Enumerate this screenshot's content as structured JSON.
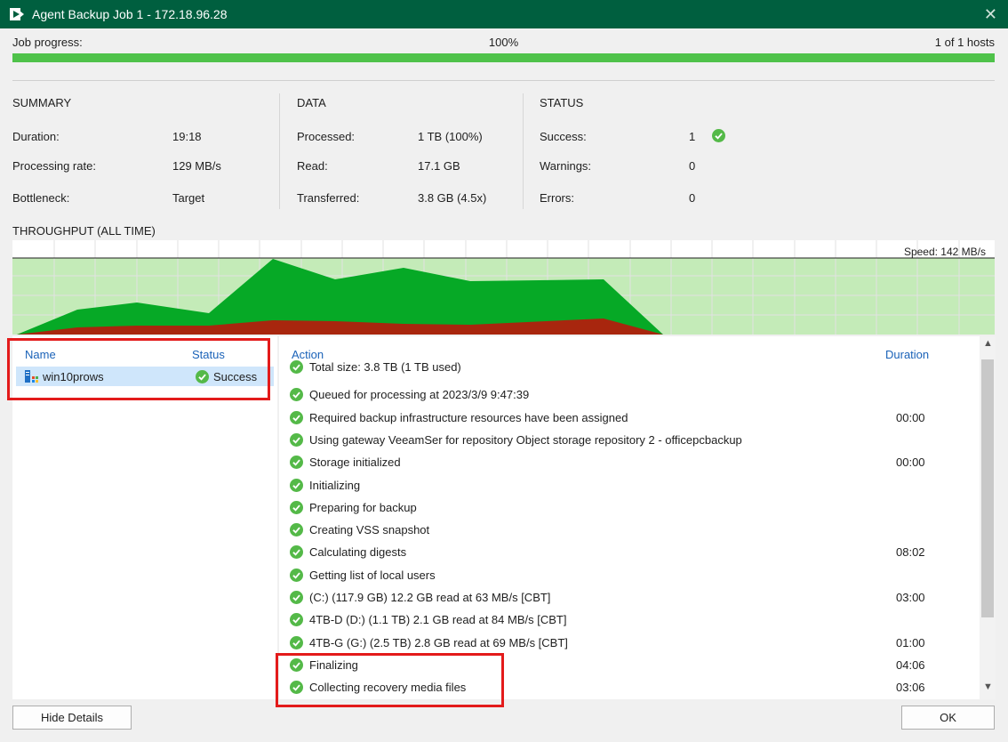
{
  "window": {
    "title": "Agent Backup Job 1 - 172.18.96.28"
  },
  "progress": {
    "label": "Job progress:",
    "percent_text": "100%",
    "hosts": "1 of 1 hosts",
    "fraction": 1.0,
    "color": "#4fc24a"
  },
  "summary": {
    "header": "SUMMARY",
    "rows": [
      {
        "label": "Duration:",
        "value": "19:18"
      },
      {
        "label": "Processing rate:",
        "value": "129 MB/s"
      },
      {
        "label": "Bottleneck:",
        "value": "Target"
      }
    ]
  },
  "data_stats": {
    "header": "DATA",
    "rows": [
      {
        "label": "Processed:",
        "value": "1 TB (100%)"
      },
      {
        "label": "Read:",
        "value": "17.1 GB"
      },
      {
        "label": "Transferred:",
        "value": "3.8 GB (4.5x)"
      }
    ]
  },
  "status_stats": {
    "header": "STATUS",
    "rows": [
      {
        "label": "Success:",
        "value": "1",
        "icon": "success-check-icon"
      },
      {
        "label": "Warnings:",
        "value": "0"
      },
      {
        "label": "Errors:",
        "value": "0"
      }
    ]
  },
  "throughput": {
    "label": "THROUGHPUT (ALL TIME)",
    "speed": "Speed: 142 MB/s",
    "colors": {
      "background": "#c4ebb8",
      "processing": "#06a926",
      "read": "#a8260e"
    }
  },
  "vm_list": {
    "headers": {
      "name": "Name",
      "status": "Status"
    },
    "items": [
      {
        "name": "win10prows",
        "status": "Success"
      }
    ]
  },
  "actions": {
    "headers": {
      "action": "Action",
      "duration": "Duration"
    },
    "items": [
      {
        "text": "Total size: 3.8 TB (1 TB used)",
        "duration": ""
      },
      {
        "text": "Queued for processing at 2023/3/9 9:47:39",
        "duration": ""
      },
      {
        "text": "Required backup infrastructure resources have been assigned",
        "duration": "00:00"
      },
      {
        "text": "Using gateway VeeamSer for repository Object storage repository 2 - officepcbackup",
        "duration": ""
      },
      {
        "text": "Storage initialized",
        "duration": "00:00"
      },
      {
        "text": "Initializing",
        "duration": ""
      },
      {
        "text": "Preparing for backup",
        "duration": ""
      },
      {
        "text": "Creating VSS snapshot",
        "duration": ""
      },
      {
        "text": "Calculating digests",
        "duration": "08:02"
      },
      {
        "text": "Getting list of local users",
        "duration": ""
      },
      {
        "text": "(C:) (117.9 GB) 12.2 GB read at 63 MB/s [CBT]",
        "duration": "03:00"
      },
      {
        "text": "4TB-D (D:) (1.1 TB) 2.1 GB read at 84 MB/s [CBT]",
        "duration": ""
      },
      {
        "text": "4TB-G (G:) (2.5 TB) 2.8 GB read at 69 MB/s [CBT]",
        "duration": "01:00"
      },
      {
        "text": "Finalizing",
        "duration": "04:06"
      },
      {
        "text": "Collecting recovery media files",
        "duration": "03:06"
      }
    ]
  },
  "buttons": {
    "hide_details": "Hide Details",
    "ok": "OK"
  },
  "accent": {
    "highlight": "#e31b1b",
    "title_bar": "#005f3f",
    "link": "#1a62b8",
    "selected_row": "#cfe6fb"
  }
}
